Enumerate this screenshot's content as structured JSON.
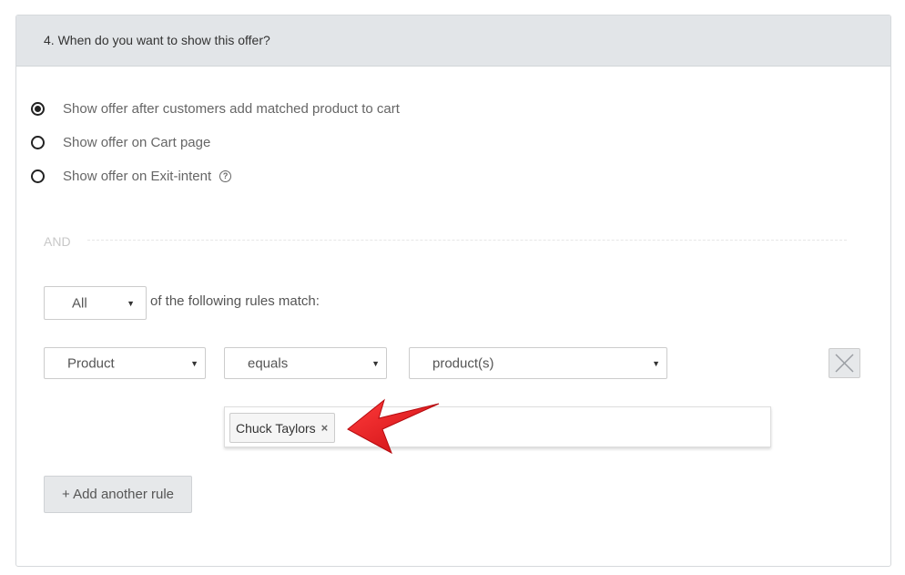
{
  "panel": {
    "title": "4. When do you want to show this offer?"
  },
  "display_options": [
    {
      "label": "Show offer after customers add matched product to cart",
      "checked": true
    },
    {
      "label": "Show offer on Cart page",
      "checked": false
    },
    {
      "label": "Show offer on Exit-intent",
      "checked": false,
      "help_icon": "question-circle-icon"
    }
  ],
  "divider": {
    "label": "AND"
  },
  "match": {
    "selected": "All",
    "suffix": "of the following rules match:"
  },
  "rule": {
    "field": "Product",
    "operator": "equals",
    "value": "product(s)",
    "selected_tags": [
      {
        "label": "Chuck Taylors",
        "remove_glyph": "×"
      }
    ]
  },
  "buttons": {
    "add_rule": "+ Add another rule"
  },
  "colors": {
    "header_bg": "#e2e5e8",
    "button_bg": "#e6e8ea",
    "annotation_arrow": "#e8141b"
  }
}
